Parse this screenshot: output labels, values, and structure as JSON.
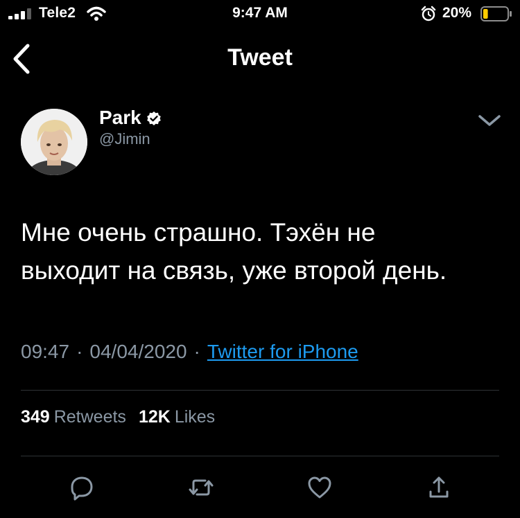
{
  "status_bar": {
    "carrier": "Tele2",
    "time": "9:47 AM",
    "battery_percent": "20%",
    "battery_level": 0.2,
    "battery_color": "#ffcc00",
    "icons": [
      "signal-icon",
      "wifi-icon",
      "alarm-icon",
      "battery-icon"
    ]
  },
  "nav": {
    "title": "Tweet",
    "back_icon": "chevron-left-icon"
  },
  "author": {
    "name": "Park",
    "handle": "@Jimin",
    "verified": true
  },
  "tweet": {
    "text": "Мне очень страшно. Тэхён не выходит на связь, уже второй день.",
    "time": "09:47",
    "date": "04/04/2020",
    "source": "Twitter for iPhone"
  },
  "stats": {
    "retweets_count": "349",
    "retweets_label": "Retweets",
    "likes_count": "12K",
    "likes_label": "Likes"
  },
  "actions": [
    "reply-icon",
    "retweet-icon",
    "like-icon",
    "share-icon"
  ],
  "colors": {
    "background": "#000000",
    "text": "#ffffff",
    "secondary": "#8b98a5",
    "link": "#1d9bf0",
    "divider": "#2f3336"
  }
}
